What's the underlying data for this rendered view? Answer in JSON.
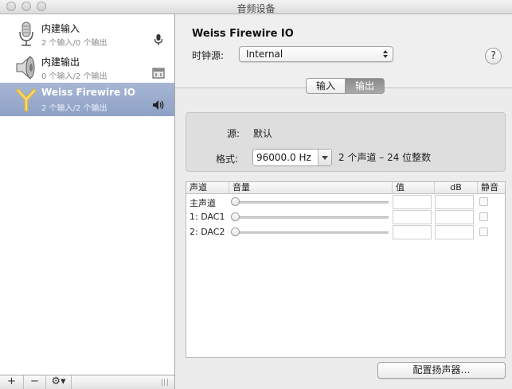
{
  "window": {
    "title": "音频设备"
  },
  "sidebar": {
    "devices": [
      {
        "name": "内建输入",
        "channels": "2 个输入/0 个输出",
        "icon": "microphone-icon",
        "state_icon": "microphone-icon",
        "selected": false
      },
      {
        "name": "内建输出",
        "channels": "0 个输入/2 个输出",
        "icon": "speaker-icon",
        "state_icon": "finder-icon",
        "selected": false
      },
      {
        "name": "Weiss Firewire IO",
        "channels": "2 个输入/2 个输出",
        "icon": "firewire-icon",
        "state_icon": "speaker-volume-icon",
        "selected": true
      }
    ],
    "bottom": {
      "add": "+",
      "remove": "−",
      "gear": "⚙▾"
    }
  },
  "detail": {
    "device_title": "Weiss Firewire IO",
    "clock_label": "时钟源:",
    "clock_value": "Internal",
    "help": "?",
    "tabs": [
      {
        "label": "输入",
        "active": false
      },
      {
        "label": "输出",
        "active": true
      }
    ],
    "source_label": "源:",
    "source_value": "默认",
    "format_label": "格式:",
    "format_value": "96000.0 Hz",
    "format_desc": "2 个声道 – 24 位整数",
    "table": {
      "headers": [
        "声道",
        "音量",
        "值",
        "dB",
        "静音"
      ],
      "rows": [
        {
          "name": "主声道"
        },
        {
          "name": "1: DAC1"
        },
        {
          "name": "2: DAC2"
        }
      ]
    },
    "configure_button": "配置扬声器…"
  },
  "colors": {
    "selection": "#97a8cb",
    "tab_active": "#9a9a9a"
  }
}
